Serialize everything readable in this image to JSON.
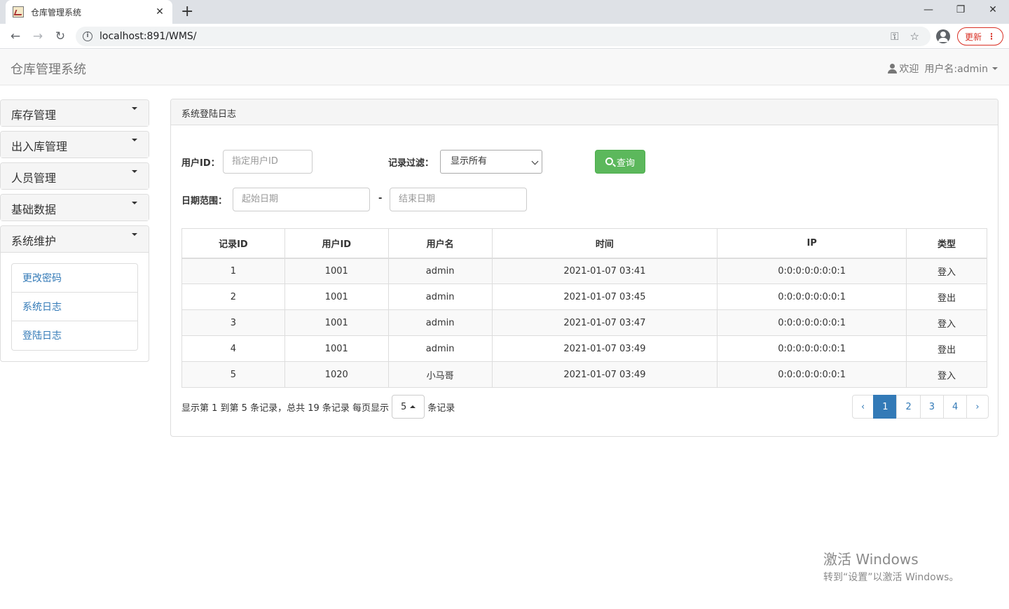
{
  "browser": {
    "tab_title": "仓库管理系统",
    "tab_close": "✕",
    "new_tab": "+",
    "url": "localhost:891/WMS/",
    "update_label": "更新",
    "menu_dots": "⋮",
    "minimize": "—",
    "maximize": "❐",
    "close": "✕",
    "back": "←",
    "forward": "→",
    "reload": "↻",
    "key_icon": "⚿",
    "star_icon": "☆"
  },
  "navbar": {
    "brand": "仓库管理系统",
    "welcome": "欢迎",
    "username_label": "用户名:admin"
  },
  "sidebar": {
    "groups": [
      {
        "label": "库存管理"
      },
      {
        "label": "出入库管理"
      },
      {
        "label": "人员管理"
      },
      {
        "label": "基础数据"
      },
      {
        "label": "系统维护"
      }
    ],
    "subitems": [
      {
        "label": "更改密码"
      },
      {
        "label": "系统日志"
      },
      {
        "label": "登陆日志"
      }
    ]
  },
  "main": {
    "panel_title": "系统登陆日志",
    "filters": {
      "user_id_label": "用户ID：",
      "user_id_placeholder": "指定用户ID",
      "record_filter_label": "记录过滤：",
      "record_filter_value": "显示所有",
      "query_label": "查询",
      "date_range_label": "日期范围：",
      "start_date_placeholder": "起始日期",
      "date_separator": "-",
      "end_date_placeholder": "结束日期"
    },
    "table": {
      "columns": [
        "记录ID",
        "用户ID",
        "用户名",
        "时间",
        "IP",
        "类型"
      ],
      "rows": [
        [
          "1",
          "1001",
          "admin",
          "2021-01-07 03:41",
          "0:0:0:0:0:0:0:1",
          "登入"
        ],
        [
          "2",
          "1001",
          "admin",
          "2021-01-07 03:45",
          "0:0:0:0:0:0:0:1",
          "登出"
        ],
        [
          "3",
          "1001",
          "admin",
          "2021-01-07 03:47",
          "0:0:0:0:0:0:0:1",
          "登入"
        ],
        [
          "4",
          "1001",
          "admin",
          "2021-01-07 03:49",
          "0:0:0:0:0:0:0:1",
          "登出"
        ],
        [
          "5",
          "1020",
          "小马哥",
          "2021-01-07 03:49",
          "0:0:0:0:0:0:0:1",
          "登入"
        ]
      ]
    },
    "footer": {
      "info_text": "显示第 1 到第 5 条记录，总共 19 条记录 每页显示",
      "page_size": "5",
      "info_suffix": "条记录",
      "prev": "‹",
      "pages": [
        "1",
        "2",
        "3",
        "4"
      ],
      "next": "›",
      "active_page": "1"
    }
  },
  "watermark": {
    "line1": "激活 Windows",
    "line2": "转到“设置”以激活 Windows。"
  }
}
